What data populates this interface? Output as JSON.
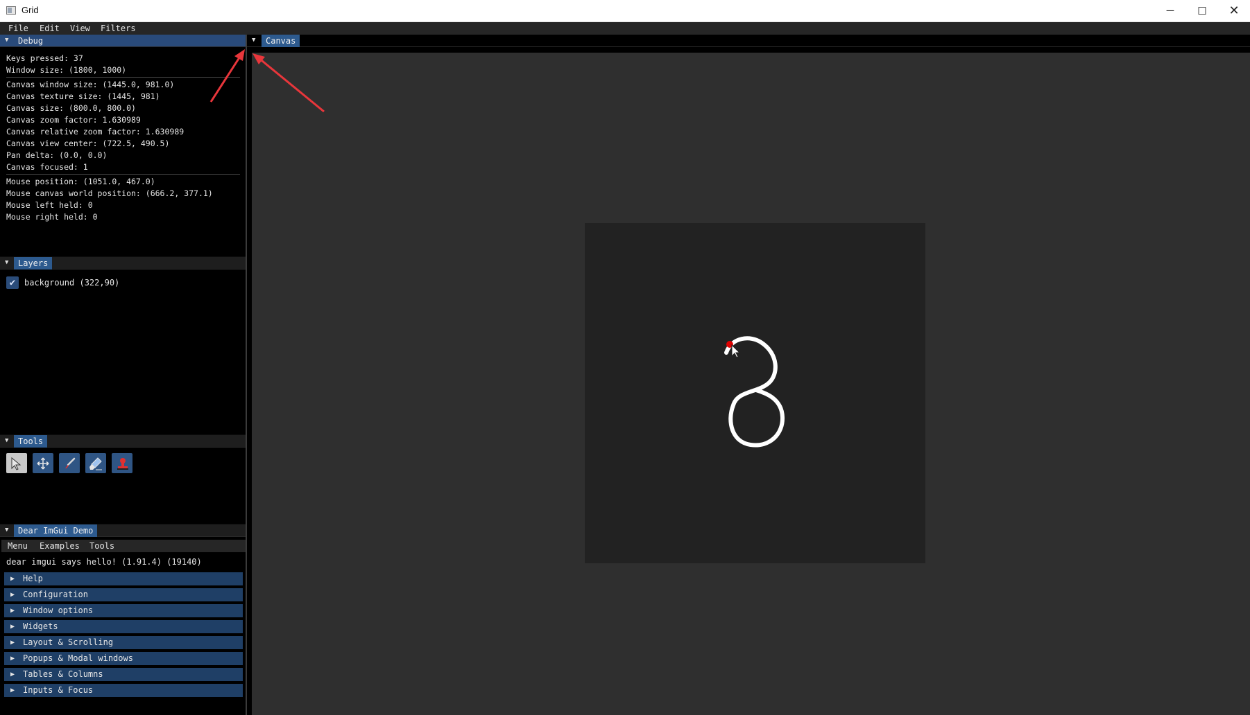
{
  "window": {
    "title": "Grid",
    "minimize_glyph": "─",
    "maximize_glyph": "☐",
    "close_glyph": "✕"
  },
  "menu": [
    "File",
    "Edit",
    "View",
    "Filters"
  ],
  "debug": {
    "tab_label": "Debug",
    "lines_group1": [
      "Keys pressed: 37",
      "Window size: (1800, 1000)"
    ],
    "lines_group2": [
      "Canvas window size: (1445.0, 981.0)",
      "Canvas texture size: (1445, 981)",
      "Canvas size: (800.0, 800.0)",
      "Canvas zoom factor: 1.630989",
      "Canvas relative zoom factor: 1.630989",
      "Canvas view center: (722.5, 490.5)",
      "Pan delta: (0.0, 0.0)",
      "Canvas focused: 1"
    ],
    "lines_group3": [
      "Mouse position: (1051.0, 467.0)",
      "Mouse canvas world position: (666.2, 377.1)",
      "Mouse left held: 0",
      "Mouse right held: 0"
    ]
  },
  "layers": {
    "tab_label": "Layers",
    "items": [
      {
        "label": "background (322,90)",
        "checked": true
      }
    ]
  },
  "tools": {
    "tab_label": "Tools",
    "items": [
      "select-tool",
      "move-tool",
      "brush-tool",
      "eraser-tool",
      "stamp-tool"
    ],
    "selected": "select-tool"
  },
  "demo": {
    "tab_label": "Dear ImGui Demo",
    "menu": [
      "Menu",
      "Examples",
      "Tools"
    ],
    "hello": "dear imgui says hello! (1.91.4) (19140)",
    "headers": [
      "Help",
      "Configuration",
      "Window options",
      "Widgets",
      "Layout & Scrolling",
      "Popups & Modal windows",
      "Tables & Columns",
      "Inputs & Focus"
    ]
  },
  "canvas": {
    "tab_label": "Canvas"
  },
  "colors": {
    "accent": "#2d5a8e",
    "header_blue": "#1f3f66",
    "canvas_bg": "#2f2f2f",
    "board_bg": "#222222",
    "stroke": "#ffffff",
    "arrow": "#e8363b",
    "cursor_dot": "#e00000"
  }
}
